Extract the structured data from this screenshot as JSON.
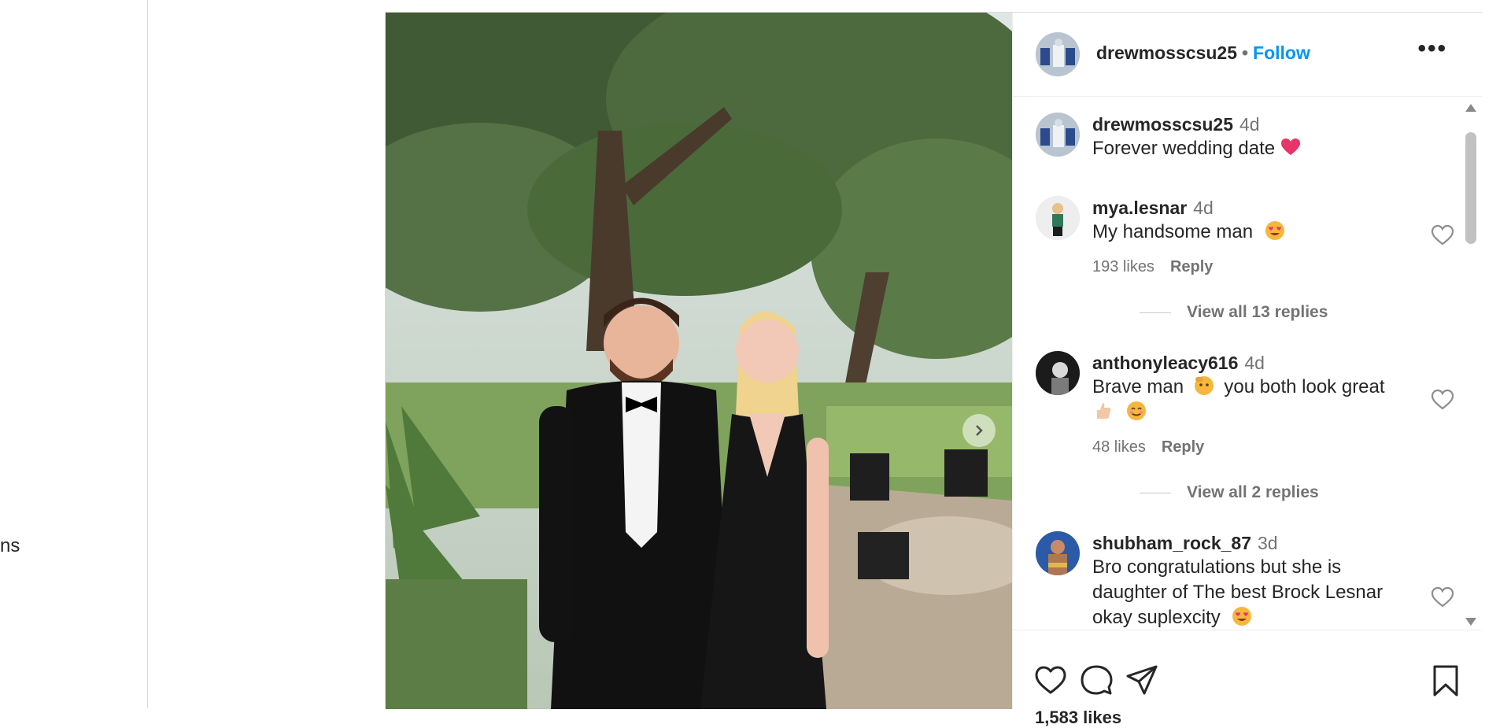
{
  "nav": {
    "partial_label": "ns"
  },
  "post": {
    "username": "drewmosscsu25",
    "separator": "•",
    "follow_label": "Follow",
    "more_label": "•••",
    "likes_text": "1,583 likes",
    "caption": {
      "username": "drewmosscsu25",
      "time": "4d",
      "text": "Forever wedding date",
      "emoji": "heart"
    }
  },
  "comments": [
    {
      "username": "mya.lesnar",
      "time": "4d",
      "text": "My handsome man",
      "emoji": "heart-eyes",
      "likes": "193 likes",
      "reply_label": "Reply",
      "view_replies": "View all 13 replies"
    },
    {
      "username": "anthonyleacy616",
      "time": "4d",
      "text_a": "Brave man",
      "text_b": "you both look great",
      "emoji_icons": [
        "saluting-face",
        "thumbs-up",
        "smiling-face"
      ],
      "likes": "48 likes",
      "reply_label": "Reply",
      "view_replies": "View all 2 replies"
    },
    {
      "username": "shubham_rock_87",
      "time": "3d",
      "text_line1": "Bro congratulations but she is",
      "text_line2": "daughter of The best Brock Lesnar",
      "text_line3": "okay suplexcity",
      "emoji": "heart-eyes"
    }
  ],
  "icons": {
    "like": "heart-icon",
    "comment": "comment-icon",
    "share": "paper-plane-icon",
    "save": "bookmark-icon",
    "next": "chevron-right-icon"
  },
  "colors": {
    "accent": "#0095f6",
    "muted": "#737373",
    "text": "#262626",
    "heart_emoji": "#e8336b"
  }
}
